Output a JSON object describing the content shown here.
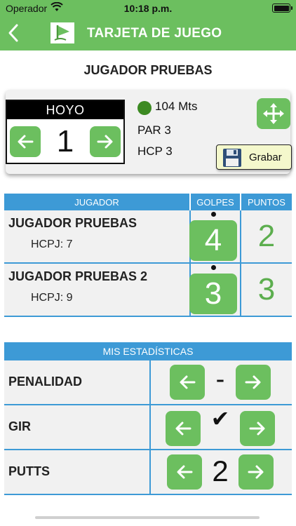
{
  "status_bar": {
    "carrier": "Operador",
    "time": "10:18 p.m."
  },
  "nav": {
    "title": "TARJETA DE JUEGO",
    "back_icon": "chevron-left-icon",
    "logo_icon": "golf-flag-logo"
  },
  "player_title": "JUGADOR PRUEBAS",
  "hole": {
    "header": "HOYO",
    "number": "1",
    "distance": "104 Mts",
    "par": "PAR 3",
    "hcp": "HCP 3",
    "distance_dot_color": "#3c8a22",
    "save_label": "Grabar"
  },
  "scores": {
    "headers": {
      "player": "JUGADOR",
      "strokes": "GOLPES",
      "points": "PUNTOS"
    },
    "rows": [
      {
        "name": "JUGADOR PRUEBAS",
        "hcpj": "HCPJ: 7",
        "golpes": "4",
        "puntos": "2"
      },
      {
        "name": "JUGADOR PRUEBAS 2",
        "hcpj": "HCPJ: 9",
        "golpes": "3",
        "puntos": "3"
      }
    ]
  },
  "stats": {
    "header": "MIS ESTADÍSTICAS",
    "rows": [
      {
        "label": "PENALIDAD",
        "value": "-"
      },
      {
        "label": "GIR",
        "value": "✔"
      },
      {
        "label": "PUTTS",
        "value": "2"
      }
    ]
  },
  "colors": {
    "accent_green": "#6cbf5f",
    "header_blue": "#3d9ad6",
    "points_green": "#5cae4e"
  }
}
